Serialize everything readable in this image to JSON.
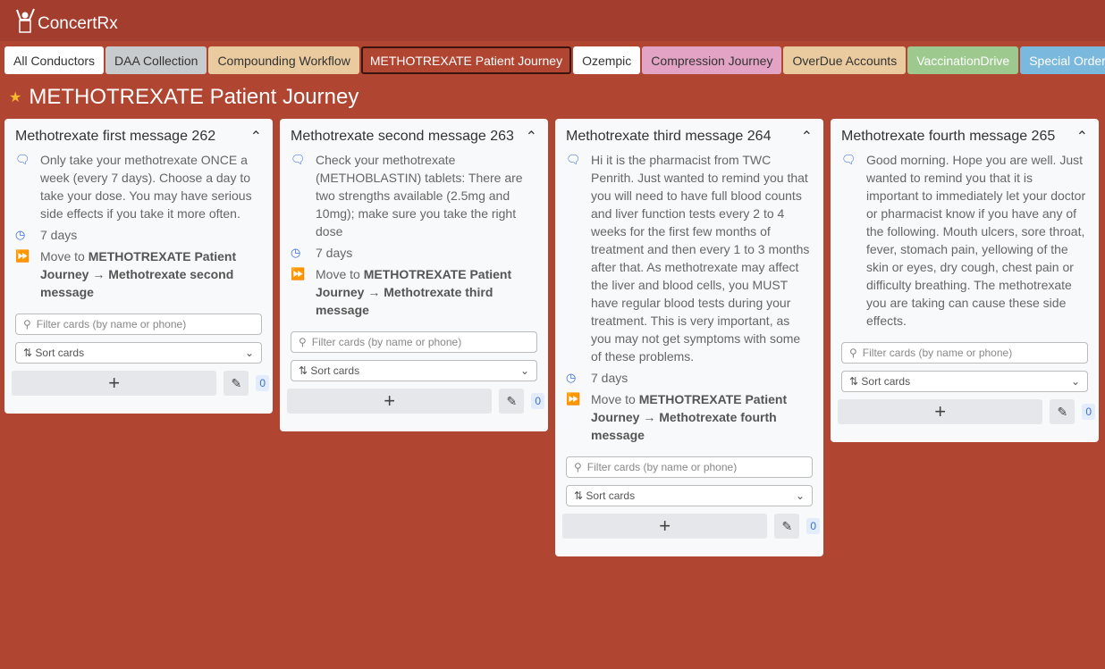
{
  "app": {
    "name": "ConcertRx"
  },
  "tabs": [
    {
      "label": "All Conductors",
      "bg": "#ffffff",
      "fg": "#333333"
    },
    {
      "label": "DAA Collection",
      "bg": "#c8cbcd",
      "fg": "#333333"
    },
    {
      "label": "Compounding Workflow",
      "bg": "#eacb9f",
      "fg": "#333333"
    },
    {
      "label": "METHOTREXATE Patient Journey",
      "bg": "#b04531",
      "fg": "#ffffff",
      "active": true
    },
    {
      "label": "Ozempic",
      "bg": "#ffffff",
      "fg": "#333333"
    },
    {
      "label": "Compression Journey",
      "bg": "#e3a3c4",
      "fg": "#333333"
    },
    {
      "label": "OverDue Accounts",
      "bg": "#eacb9f",
      "fg": "#333333"
    },
    {
      "label": "VaccinationDrive",
      "bg": "#9dc98f",
      "fg": "#ffffff"
    },
    {
      "label": "Special Orders",
      "bg": "#7ab8dd",
      "fg": "#ffffff"
    }
  ],
  "page_title": "METHOTREXATE Patient Journey",
  "filter_placeholder": "Filter cards (by name or phone)",
  "sort_label": "Sort cards",
  "columns": [
    {
      "title": "Methotrexate first message 262",
      "message": "Only take your methotrexate ONCE a week (every 7 days). Choose a day to take your dose. You may have serious side effects if you take it more often.",
      "delay": "7 days",
      "move_prefix": "Move to ",
      "move_target": "METHOTREXATE Patient Journey → Methotrexate second message",
      "count": "0"
    },
    {
      "title": "Methotrexate second message 263",
      "message": "Check your methotrexate (METHOBLASTIN) tablets: There are two strengths available (2.5mg and 10mg); make sure you take the right dose",
      "delay": "7 days",
      "move_prefix": "Move to ",
      "move_target": "METHOTREXATE Patient Journey → Methotrexate third message",
      "count": "0"
    },
    {
      "title": "Methotrexate third message 264",
      "message": "Hi it is the pharmacist from TWC Penrith. Just wanted to remind you that you will need to have full blood counts and liver function tests every 2 to 4 weeks for the first few months of treatment and then every 1 to 3 months after that. As methotrexate may affect the liver and blood cells, you MUST have regular blood tests during your treatment. This is very important, as you may not get symptoms with some of these problems.",
      "delay": "7 days",
      "move_prefix": "Move to ",
      "move_target": "METHOTREXATE Patient Journey → Methotrexate fourth message",
      "count": "0"
    },
    {
      "title": "Methotrexate fourth message 265",
      "message": "Good morning. Hope you are well. Just wanted to remind you that it is important to immediately let your doctor or pharmacist know if you have any of the following. Mouth ulcers, sore throat, fever, stomach pain, yellowing of the skin or eyes, dry cough, chest pain or difficulty breathing. The methotrexate you are taking can cause these side effects.",
      "count": "0"
    }
  ]
}
